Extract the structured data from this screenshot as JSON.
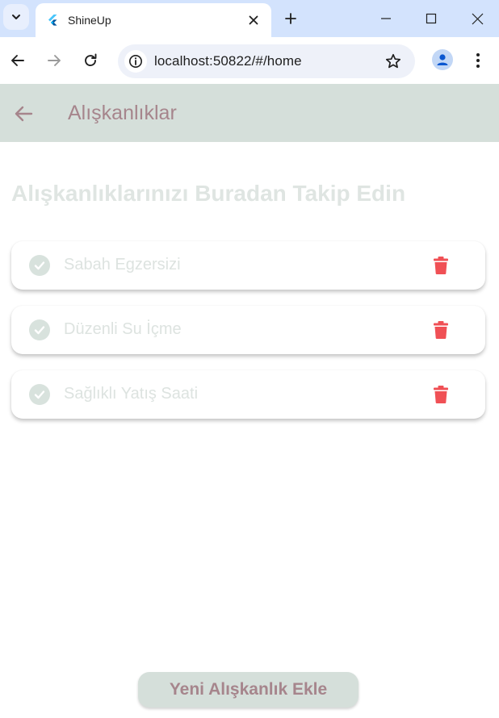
{
  "browser": {
    "tab_title": "ShineUp",
    "url": "localhost:50822/#/home",
    "icons": {
      "tab_search": "chevron-down-icon",
      "favicon": "flutter-logo-icon",
      "tab_close": "close-icon",
      "new_tab": "plus-icon",
      "minimize": "minimize-icon",
      "maximize": "maximize-icon",
      "close_window": "close-icon",
      "back": "arrow-left-icon",
      "forward": "arrow-right-icon",
      "reload": "reload-icon",
      "site_info": "info-icon",
      "bookmark": "star-icon",
      "profile": "person-icon",
      "menu": "more-vert-icon"
    }
  },
  "app": {
    "title": "Alışkanlıklar",
    "heading": "Alışkanlıklarınızı Buradan Takip Edin",
    "habits": [
      {
        "label": "Sabah Egzersizi",
        "completed_icon": "check-circle-icon",
        "delete_icon": "trash-icon"
      },
      {
        "label": "Düzenli Su İçme",
        "completed_icon": "check-circle-icon",
        "delete_icon": "trash-icon"
      },
      {
        "label": "Sağlıklı Yatış Saati",
        "completed_icon": "check-circle-icon",
        "delete_icon": "trash-icon"
      }
    ],
    "add_button_label": "Yeni Alışkanlık Ekle",
    "colors": {
      "appbar_bg": "#d5dfda",
      "accent_text": "#a6858c",
      "muted_text": "#dde3e0",
      "delete_red": "#f05055"
    }
  }
}
